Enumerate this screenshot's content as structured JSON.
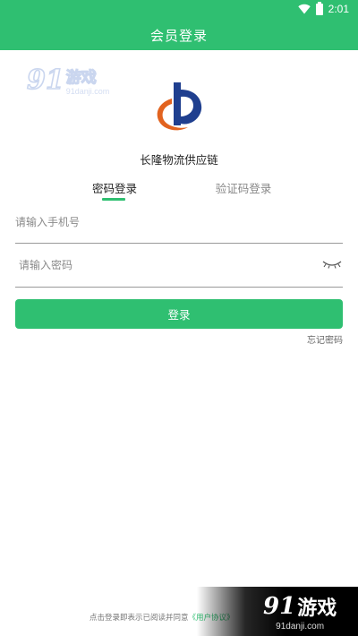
{
  "status_bar": {
    "time": "2:01"
  },
  "header": {
    "title": "会员登录"
  },
  "watermark": {
    "number": "91",
    "brand": "游戏",
    "domain": "91danji.com"
  },
  "company": {
    "name": "长隆物流供应链"
  },
  "tabs": [
    {
      "label": "密码登录",
      "active": true
    },
    {
      "label": "验证码登录",
      "active": false
    }
  ],
  "form": {
    "phone_placeholder": "请输入手机号",
    "phone_value": "",
    "password_placeholder": "请输入密码",
    "password_value": "",
    "login_label": "登录",
    "forgot_label": "忘记密码"
  },
  "footer": {
    "agreement_text": "点击登录即表示已阅读并同意",
    "agreement_link": "《用户协议》"
  },
  "colors": {
    "accent": "#2fbf71",
    "logo_blue": "#1f3f8f",
    "logo_orange": "#e2631f"
  }
}
